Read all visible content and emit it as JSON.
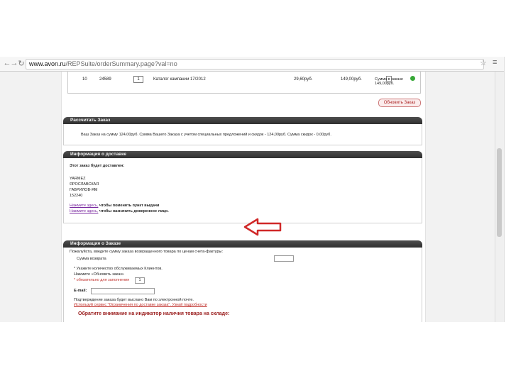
{
  "browser": {
    "url_domain": "www.avon.ru",
    "url_path": "/REPSuite/orderSummary.page?val=no",
    "back_icon": "back-arrow-icon",
    "forward_icon": "forward-arrow-icon",
    "reload_icon": "reload-icon",
    "star_icon": "bookmark-star-icon",
    "menu_icon": "menu-icon"
  },
  "order_row": {
    "num": "10",
    "code": "24589",
    "qty": "1",
    "catalog": "Каталог кампании 17/2012",
    "price": "29,60руб.",
    "total": "149,00руб.",
    "sum_line": "Сумма в заказе 149,00руб."
  },
  "recalc_button": "Обновить Заказ",
  "sections": {
    "calc": {
      "title": "Рассчитать Заказ",
      "text": "Ваш Заказ на сумму 124,00руб. Сумма Вашего Заказа с учетом специальных предложений и скидок - 124,00руб. Сумма скидок - 0,00руб."
    },
    "delivery": {
      "title": "Информация о доставке",
      "intro": "Этот заказ будет доставлен:",
      "address": [
        "YARMEZ",
        "ЯРОСЛАВСКАЯ",
        "ГАВРИЛОВ-ЯМ",
        "152240"
      ],
      "link1": "Нажмите здесь,",
      "link1_rest": " чтобы поменять пункт выдачи",
      "link2": "Нажмите здесь,",
      "link2_rest": " чтобы назначить доверенное лицо."
    },
    "order_info": {
      "title": "Информация о Заказе",
      "refund_prompt": "Пожалуйста, введите сумму заказа возвращенного товара по ценам счета-фактуры:",
      "refund_label": "Сумма возврата",
      "note1": "* Укажите количество обслуживаемых Клиентов.",
      "note2": "Нажмите «Обновить заказ»",
      "note3": "* обязательно для заполнения",
      "clients_value": "1",
      "email_label": "E-mail:",
      "confirm_text": "Подтверждение заказа будет выслано Вам по электронной почте.",
      "confirm_link": "Используй сервис \"Ограничения по доставке заказа\". Узнай подробности",
      "attention": "Обратите внимание на индикатор наличия товара на складе:"
    }
  },
  "colors": {
    "header_bg": "#3a3a3a",
    "link": "#7a2aa0",
    "arrow": "#d02828",
    "stock_dot": "#38a838"
  }
}
